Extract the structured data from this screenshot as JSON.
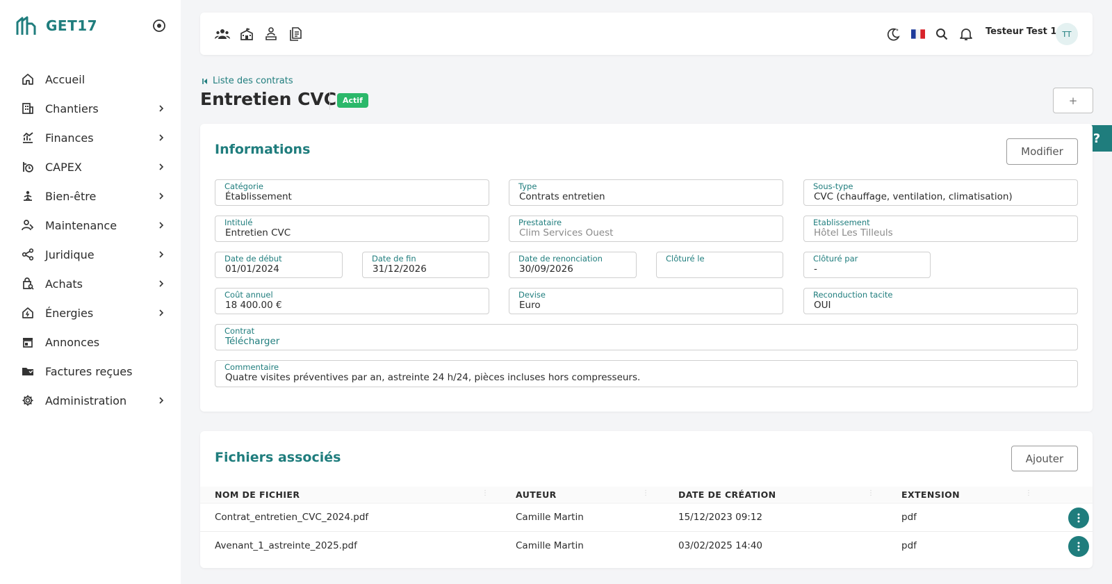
{
  "app": {
    "name": "GET17"
  },
  "sidebar": {
    "items": [
      {
        "label": "Accueil",
        "icon": "home-icon",
        "has_children": false
      },
      {
        "label": "Chantiers",
        "icon": "building-icon",
        "has_children": true
      },
      {
        "label": "Finances",
        "icon": "finance-chart-icon",
        "has_children": true
      },
      {
        "label": "CAPEX",
        "icon": "capex-icon",
        "has_children": true
      },
      {
        "label": "Bien-être",
        "icon": "wellbeing-icon",
        "has_children": true
      },
      {
        "label": "Maintenance",
        "icon": "maintenance-icon",
        "has_children": true
      },
      {
        "label": "Juridique",
        "icon": "share-icon",
        "has_children": true
      },
      {
        "label": "Achats",
        "icon": "shopping-bag-icon",
        "has_children": true
      },
      {
        "label": "Énergies",
        "icon": "energy-home-icon",
        "has_children": true
      },
      {
        "label": "Annonces",
        "icon": "store-icon",
        "has_children": false
      },
      {
        "label": "Factures reçues",
        "icon": "folder-icon",
        "has_children": false
      },
      {
        "label": "Administration",
        "icon": "gear-icon",
        "has_children": true
      }
    ]
  },
  "topbar": {
    "left_icons": [
      "people-icon",
      "school-icon",
      "person-desk-icon",
      "document-icon"
    ],
    "right_icons": [
      "dark-mode-icon",
      "french-flag-icon",
      "search-icon",
      "bell-icon"
    ],
    "user_name": "Testeur Test 1",
    "user_initials": "TT"
  },
  "header": {
    "breadcrumb": "Liste des contrats",
    "title": "Entretien CVC",
    "status": "Actif",
    "add_label": "+"
  },
  "help": {
    "label": "?"
  },
  "info": {
    "title": "Informations",
    "edit_label": "Modifier",
    "fields": {
      "categorie": {
        "label": "Catégorie",
        "value": "Établissement"
      },
      "type": {
        "label": "Type",
        "value": "Contrats entretien"
      },
      "sous_type": {
        "label": "Sous-type",
        "value": "CVC (chauffage, ventilation, climatisation)"
      },
      "intitule": {
        "label": "Intitulé",
        "value": "Entretien CVC"
      },
      "prestataire": {
        "label": "Prestataire",
        "value": "Clim Services Ouest"
      },
      "etablissement": {
        "label": "Etablissement",
        "value": "Hôtel Les Tilleuls"
      },
      "date_debut": {
        "label": "Date de début",
        "value": "01/01/2024"
      },
      "date_fin": {
        "label": "Date de fin",
        "value": "31/12/2026"
      },
      "date_renonciation": {
        "label": "Date de renonciation",
        "value": "30/09/2026"
      },
      "cloture_le": {
        "label": "Clôturé le",
        "value": ""
      },
      "cloture_par": {
        "label": "Clôturé par",
        "value": "-"
      },
      "cout_annuel": {
        "label": "Coût annuel",
        "value": "18 400.00 €"
      },
      "devise": {
        "label": "Devise",
        "value": "Euro"
      },
      "reconduction": {
        "label": "Reconduction tacite",
        "value": "OUI"
      },
      "contrat": {
        "label": "Contrat",
        "value": "Télécharger"
      },
      "commentaire": {
        "label": "Commentaire",
        "value": "Quatre visites préventives par an, astreinte 24 h/24, pièces incluses hors compresseurs."
      }
    }
  },
  "files": {
    "title": "Fichiers associés",
    "add_label": "Ajouter",
    "columns": [
      "NOM DE FICHIER",
      "AUTEUR",
      "DATE DE CRÉATION",
      "EXTENSION"
    ],
    "rows": [
      {
        "name": "Contrat_entretien_CVC_2024.pdf",
        "author": "Camille Martin",
        "created": "15/12/2023 09:12",
        "ext": "pdf"
      },
      {
        "name": "Avenant_1_astreinte_2025.pdf",
        "author": "Camille Martin",
        "created": "03/02/2025 14:40",
        "ext": "pdf"
      }
    ]
  },
  "colors": {
    "accent": "#1f7d7d",
    "status_active": "#2bb86a",
    "background": "#f4f5f7"
  }
}
